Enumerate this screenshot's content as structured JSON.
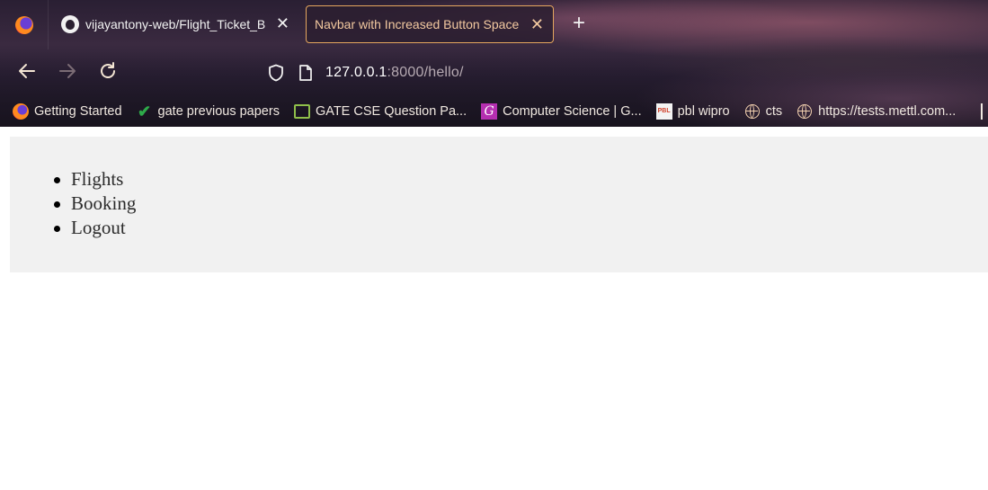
{
  "browser": {
    "tabs": [
      {
        "title": "vijayantony-web/Flight_Ticket_B",
        "icon": "github-icon",
        "active": false
      },
      {
        "title": "Navbar with Increased Button Space",
        "icon": "",
        "active": true
      }
    ],
    "new_tab_symbol": "+",
    "close_symbol": "✕",
    "url_host": "127.0.0.1",
    "url_rest": ":8000/hello/",
    "bookmarks": [
      {
        "label": "Getting Started",
        "icon": "firefox-icon"
      },
      {
        "label": "gate previous papers",
        "icon": "checkmark-icon"
      },
      {
        "label": "GATE CSE Question Pa...",
        "icon": "books-icon"
      },
      {
        "label": "Computer Science | G...",
        "icon": "g-icon",
        "icon_text": "G"
      },
      {
        "label": "pbl wipro",
        "icon": "pbl-icon",
        "icon_text": "PBL"
      },
      {
        "label": "cts",
        "icon": "globe-icon"
      },
      {
        "label": "https://tests.mettl.com...",
        "icon": "globe-icon"
      }
    ],
    "colors": {
      "active_tab_border": "#e5a65e",
      "active_tab_text": "#f3c9a0"
    }
  },
  "page": {
    "nav_items": [
      "Flights",
      "Booking",
      "Logout"
    ],
    "colors": {
      "panel_bg": "#f1f1f1",
      "text": "#2b2b2b"
    }
  }
}
